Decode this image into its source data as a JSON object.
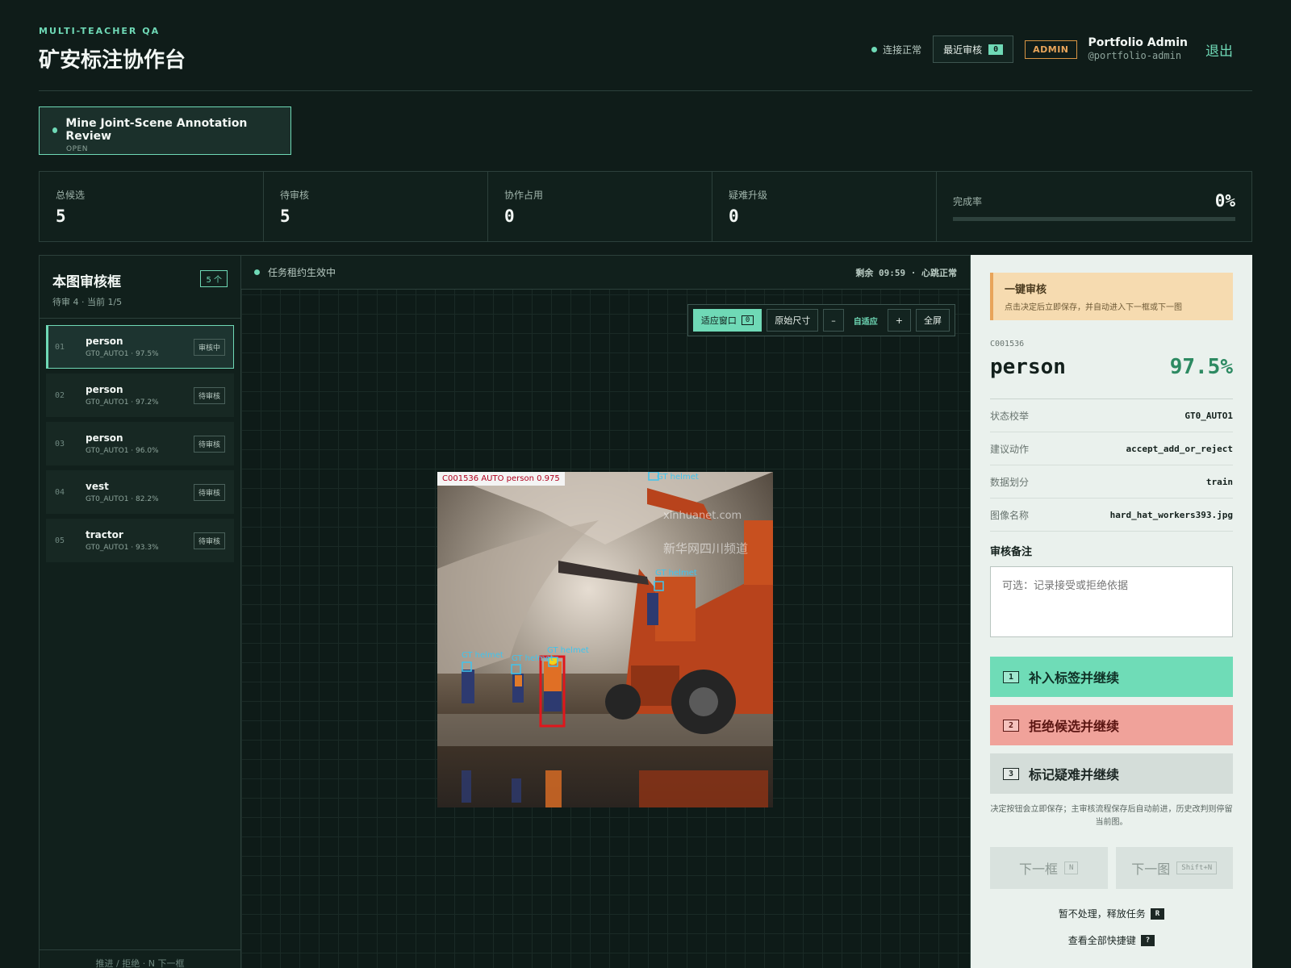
{
  "header": {
    "eyebrow": "MULTI-TEACHER QA",
    "title": "矿安标注协作台",
    "connection": "连接正常",
    "recent_label": "最近审核",
    "recent_count": "0",
    "role": "ADMIN",
    "user_name": "Portfolio Admin",
    "user_handle": "@portfolio-admin",
    "logout": "退出"
  },
  "project": {
    "name": "Mine Joint-Scene Annotation Review",
    "status": "OPEN"
  },
  "stats": {
    "total_label": "总候选",
    "total": "5",
    "pending_label": "待审核",
    "pending": "5",
    "locked_label": "协作占用",
    "locked": "0",
    "escalated_label": "疑难升级",
    "escalated": "0",
    "complete_label": "完成率",
    "complete": "0%",
    "complete_fraction": 0
  },
  "candidates_panel": {
    "title": "本图审核框",
    "subtitle": "待审 4 · 当前 1/5",
    "count": "5 个",
    "footer": "推进 / 拒绝 · N 下一框",
    "items": [
      {
        "idx": "01",
        "label": "person",
        "meta": "GT0_AUTO1 · 97.5%",
        "state": "审核中",
        "active": true
      },
      {
        "idx": "02",
        "label": "person",
        "meta": "GT0_AUTO1 · 97.2%",
        "state": "待审核",
        "active": false
      },
      {
        "idx": "03",
        "label": "person",
        "meta": "GT0_AUTO1 · 96.0%",
        "state": "待审核",
        "active": false
      },
      {
        "idx": "04",
        "label": "vest",
        "meta": "GT0_AUTO1 · 82.2%",
        "state": "待审核",
        "active": false
      },
      {
        "idx": "05",
        "label": "tractor",
        "meta": "GT0_AUTO1 · 93.3%",
        "state": "待审核",
        "active": false
      }
    ]
  },
  "viewer": {
    "lease": "任务租约生效中",
    "timer": "剩余 09:59 · 心跳正常",
    "fit_label": "适应窗口",
    "fit_key": "0",
    "original_label": "原始尺寸",
    "zoom_out": "–",
    "zoom_mode": "自适应",
    "zoom_in": "+",
    "fullscreen": "全屏",
    "detection_tag": "C001536 AUTO person 0.975",
    "gt_label": "GT helmet",
    "watermark_1": "xinhuanet.com",
    "watermark_2": "新华网四川频道"
  },
  "review": {
    "hint_title": "一键审核",
    "hint_text": "点击决定后立即保存，并自动进入下一框或下一图",
    "candidate_id": "C001536",
    "label": "person",
    "score": "97.5%",
    "fields": [
      {
        "key": "状态校举",
        "value": "GT0_AUTO1"
      },
      {
        "key": "建议动作",
        "value": "accept_add_or_reject"
      },
      {
        "key": "数据划分",
        "value": "train"
      },
      {
        "key": "图像名称",
        "value": "hard_hat_workers393.jpg"
      }
    ],
    "note_title": "审核备注",
    "note_placeholder": "可选：记录接受或拒绝依据",
    "accept_key": "1",
    "accept_label": "补入标签并继续",
    "reject_key": "2",
    "reject_label": "拒绝候选并继续",
    "hard_key": "3",
    "hard_label": "标记疑难并继续",
    "action_note": "决定按钮会立即保存；主审核流程保存后自动前进，历史改判则停留当前图。",
    "next_box_label": "下一框",
    "next_box_key": "N",
    "next_image_label": "下一图",
    "next_image_key": "Shift+N",
    "release_label": "暂不处理，释放任务",
    "release_key": "R",
    "shortcuts_label": "查看全部快捷键",
    "shortcuts_key": "?"
  },
  "colors": {
    "accent": "#6fd9b6",
    "reject": "#f0a29a",
    "warning": "#e8a45a",
    "bbox": "#e0161c",
    "gt": "#3fc4ee"
  }
}
